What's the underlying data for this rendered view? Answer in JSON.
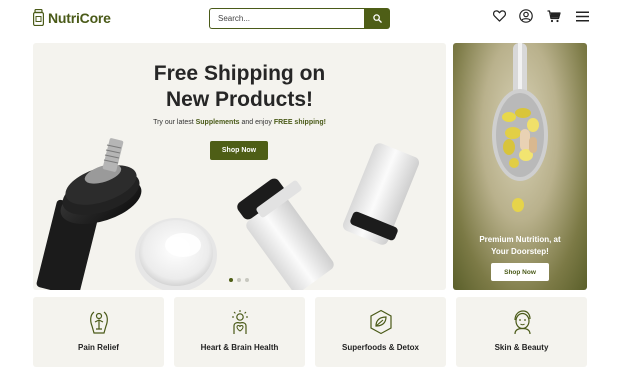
{
  "brand": {
    "name": "NutriCore",
    "accent": "#4e5e16"
  },
  "search": {
    "placeholder": "Search...",
    "icon": "search-icon"
  },
  "nav": {
    "icons": [
      "heart-icon",
      "account-icon",
      "cart-icon",
      "menu-icon"
    ]
  },
  "hero": {
    "title_line1": "Free Shipping on",
    "title_line2": "New Products!",
    "subtitle_pre": "Try our latest ",
    "subtitle_highlight1": "Supplements",
    "subtitle_mid": " and enjoy ",
    "subtitle_highlight2": "FREE shipping!",
    "button": "Shop Now",
    "slides_total": 3,
    "slide_active": 1
  },
  "promo": {
    "title_line1": "Premium Nutrition, at",
    "title_line2": "Your Doorstep!",
    "button": "Shop Now"
  },
  "categories": [
    {
      "label": "Pain Relief",
      "icon": "body-icon"
    },
    {
      "label": "Heart & Brain Health",
      "icon": "heart-brain-icon"
    },
    {
      "label": "Superfoods & Detox",
      "icon": "leaf-icon"
    },
    {
      "label": "Skin & Beauty",
      "icon": "face-icon"
    }
  ]
}
